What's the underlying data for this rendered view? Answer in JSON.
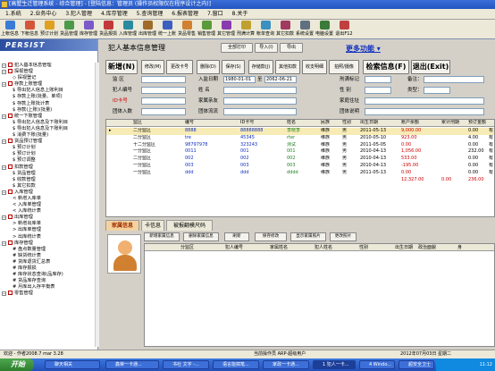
{
  "window": {
    "title": "[高墅生迁管理系统 - 综合管理] - [登陆信息：管理员 (操作员权限仅在程序设计之内)]"
  },
  "menu": [
    "1.系统",
    "2.业务中心",
    "3.犯人管理",
    "4.库存管理",
    "5.查询管理",
    "6.报表管理",
    "7.窗口",
    "8.关于"
  ],
  "toolbar": [
    "上帐信息",
    "下帐信息",
    "预订计划",
    "货品管理",
    "库存管理",
    "货品报损",
    "入库管理",
    "出库管理",
    "统一上账",
    "货品零售",
    "销售管理",
    "其它管理",
    "刑满计算",
    "帐单查询",
    "其它扣款",
    "系统设置",
    "电脑设置",
    "退出F12"
  ],
  "sidebar": {
    "title": "PERSIST",
    "tree": [
      {
        "lvl": 0,
        "text": "犯人基本信息管理",
        "checked": true
      },
      {
        "lvl": 0,
        "text": "探视管理",
        "checked": false
      },
      {
        "lvl": 1,
        "text": "◇ 探视登记"
      },
      {
        "lvl": 0,
        "text": "存款上账管理",
        "checked": false
      },
      {
        "lvl": 1,
        "text": "$ 导出犯人信息上账利目"
      },
      {
        "lvl": 1,
        "text": "$ 存款上账(批量、单项)"
      },
      {
        "lvl": 1,
        "text": "$ 存款上账批计表"
      },
      {
        "lvl": 1,
        "text": "$ 存款(上账)(批量)"
      },
      {
        "lvl": 0,
        "text": "统一下账管理",
        "checked": false
      },
      {
        "lvl": 1,
        "text": "$ 导出犯人信息及下账利目"
      },
      {
        "lvl": 1,
        "text": "$ 导出犯人信息及下账利目"
      },
      {
        "lvl": 1,
        "text": "$ 消费下账(批量)"
      },
      {
        "lvl": 0,
        "text": "货品预订管理",
        "checked": false
      },
      {
        "lvl": 1,
        "text": "$ 预订计划"
      },
      {
        "lvl": 1,
        "text": "$ 预订计划"
      },
      {
        "lvl": 1,
        "text": "$ 预订调整"
      },
      {
        "lvl": 0,
        "text": "扣款管理",
        "checked": false
      },
      {
        "lvl": 1,
        "text": "$ 货品管理"
      },
      {
        "lvl": 1,
        "text": "$ 收款管理"
      },
      {
        "lvl": 1,
        "text": "$ 其它扣款"
      },
      {
        "lvl": 0,
        "text": "入库管理",
        "checked": false
      },
      {
        "lvl": 1,
        "text": "< 新增入库单"
      },
      {
        "lvl": 1,
        "text": "< 入库单管理"
      },
      {
        "lvl": 1,
        "text": "< 入库统计表"
      },
      {
        "lvl": 0,
        "text": "出库管理",
        "checked": false
      },
      {
        "lvl": 1,
        "text": "> 新增出库单"
      },
      {
        "lvl": 1,
        "text": "> 出库单管理"
      },
      {
        "lvl": 1,
        "text": "> 出库统计表"
      },
      {
        "lvl": 0,
        "text": "库存管理",
        "checked": false
      },
      {
        "lvl": 1,
        "text": "# 盘点数量管理"
      },
      {
        "lvl": 1,
        "text": "# 缺货统计表"
      },
      {
        "lvl": 1,
        "text": "# 货库退货汇总表"
      },
      {
        "lvl": 1,
        "text": "# 库存报损"
      },
      {
        "lvl": 1,
        "text": "# 库存状态查询(品库存)"
      },
      {
        "lvl": 1,
        "text": "# 货品库存查询"
      },
      {
        "lvl": 1,
        "text": "# 月库出入存平衡表"
      },
      {
        "lvl": 0,
        "text": "零售管理",
        "checked": false
      }
    ]
  },
  "main": {
    "title": "犯人基本信息管理",
    "top_buttons": [
      "全部打印",
      "导入(I)",
      "导出"
    ],
    "more_link": "更多功能",
    "actions": [
      "新增(N)",
      "修改(M)",
      "更改卡号",
      "删除(D)",
      "保存(S)",
      "存储款(J)",
      "其他扣款",
      "收支明细",
      "拍照/摄像",
      "检索信息(F)",
      "退出(Exit)"
    ],
    "form": {
      "area_label": "监  区",
      "in_date_label": "入监日期",
      "date_from": "1980-01-01",
      "date_to": "2062-06-21",
      "to_label": "至",
      "release_label": "刑满标记",
      "remark_label": "备注：",
      "id_label": "犯人编号",
      "name_label": "姓  名",
      "gender_label": "性  别",
      "type_label": "类型：",
      "card_label": "ID卡号",
      "family_label": "家属亲友",
      "family_addr_label": "家庭住址",
      "batch_label": "团体入数",
      "batch2_label": "团体流流",
      "batch_desc_label": "团体说明"
    },
    "grid": {
      "columns": [
        "监区",
        "编号",
        "ID卡号",
        "姓名",
        "民族",
        "性别",
        "出生日期",
        "账户余额",
        "累计刑期",
        "预订金额"
      ],
      "rows": [
        [
          "二分监区",
          "8888",
          "88888888",
          "李晓李",
          "维族",
          "男",
          "2011-05-13",
          "9,000.00",
          "",
          "0.00",
          "有"
        ],
        [
          "二分监区",
          "tre",
          "45345",
          "rter",
          "维族",
          "男",
          "2010-05-10",
          "923.00",
          "",
          "4.00",
          "有"
        ],
        [
          "十二分监区",
          "98797978",
          "323243",
          "测试",
          "维族",
          "男",
          "2011-05-05",
          "0.00",
          "",
          "0.00",
          "有"
        ],
        [
          "一分监区",
          "0011",
          "001",
          "001",
          "维族",
          "男",
          "2010-04-13",
          "1,056.00",
          "",
          "232.00",
          "有"
        ],
        [
          "二分监区",
          "002",
          "002",
          "002",
          "维族",
          "男",
          "2010-04-13",
          "533.00",
          "",
          "0.00",
          "有"
        ],
        [
          "一分监区",
          "003",
          "003",
          "003",
          "维族",
          "男",
          "2010-04-13",
          "-195.00",
          "",
          "0.00",
          "有"
        ],
        [
          "一分监区",
          "ddd",
          "ddd",
          "dddd",
          "维族",
          "男",
          "2011-05-13",
          "0.00",
          "",
          "0.00",
          "有"
        ]
      ],
      "total": [
        "12,327.00",
        "0.00",
        "236.00"
      ]
    },
    "tabs": [
      "家属信息",
      "卡信息",
      "被报翻模尺码"
    ],
    "sub_buttons": [
      "新增家属信息",
      "删除家属信息",
      "刷新",
      "保存修改",
      "显示家属照片",
      "更改照片"
    ],
    "sub_grid_columns": [
      "分监区",
      "犯人编号",
      "家属姓名",
      "犯人姓名",
      "性别",
      "出生日期",
      "政治面貌",
      "身"
    ]
  },
  "status": {
    "left": "欢迎 - 作者2008.7 mar 3.28",
    "middle": "当前操作员 ARP-超级用户",
    "right": "2012年07月03日 星期二"
  },
  "taskbar": {
    "start": "开始",
    "items": [
      "聊天相关",
      "鑫荣一卡通...",
      "书社 文字 -...",
      "语言能搞笔...",
      "家政一卡通...",
      "1 犯人一卡...",
      "4 Windo...",
      "超安全卫士"
    ],
    "time": "11:12"
  }
}
